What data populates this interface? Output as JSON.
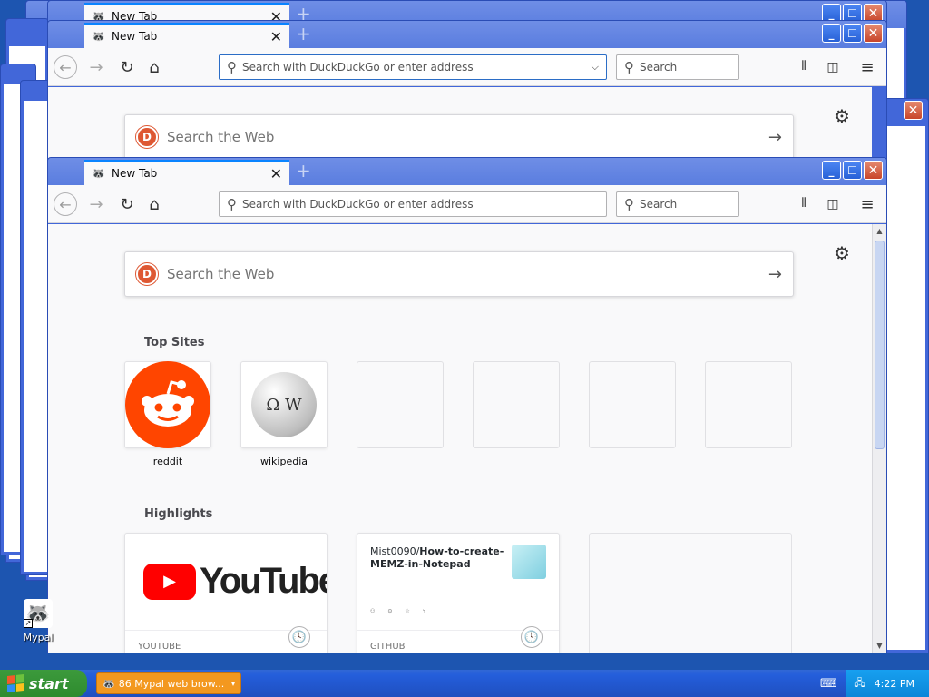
{
  "browser": {
    "tab_title": "New Tab",
    "new_tab_symbol": "+",
    "close_tab_symbol": "✕",
    "address_placeholder": "Search with DuckDuckGo or enter address",
    "search_placeholder": "Search",
    "caption": {
      "minimize": "_",
      "maximize": "☐",
      "close": "✕"
    }
  },
  "newtab": {
    "search_placeholder": "Search the Web",
    "top_sites_title": "Top Sites",
    "highlights_title": "Highlights",
    "top_sites": [
      {
        "name": "reddit"
      },
      {
        "name": "wikipedia"
      },
      {
        "name": ""
      },
      {
        "name": ""
      },
      {
        "name": ""
      },
      {
        "name": ""
      }
    ],
    "highlights": [
      {
        "source": "YOUTUBE",
        "logo_text": "YouTube"
      },
      {
        "source": "GITHUB",
        "repo_owner": "Mist0090/",
        "repo_name": "How-to-create-MEMZ-in-Notepad"
      }
    ]
  },
  "desktop": {
    "icon_label": "Mypal"
  },
  "taskbar": {
    "start_label": "start",
    "task_item_label": "86 Mypal web brow...",
    "clock": "4:22 PM"
  },
  "colors": {
    "reddit": "#ff4500",
    "youtube": "#ff0000",
    "duckduckgo": "#de5833",
    "accent": "#0a84ff"
  },
  "icons": [
    "back-icon",
    "forward-icon",
    "reload-icon",
    "home-icon",
    "library-icon",
    "sidebar-icon",
    "menu-icon",
    "gear-icon",
    "clock-icon"
  ]
}
